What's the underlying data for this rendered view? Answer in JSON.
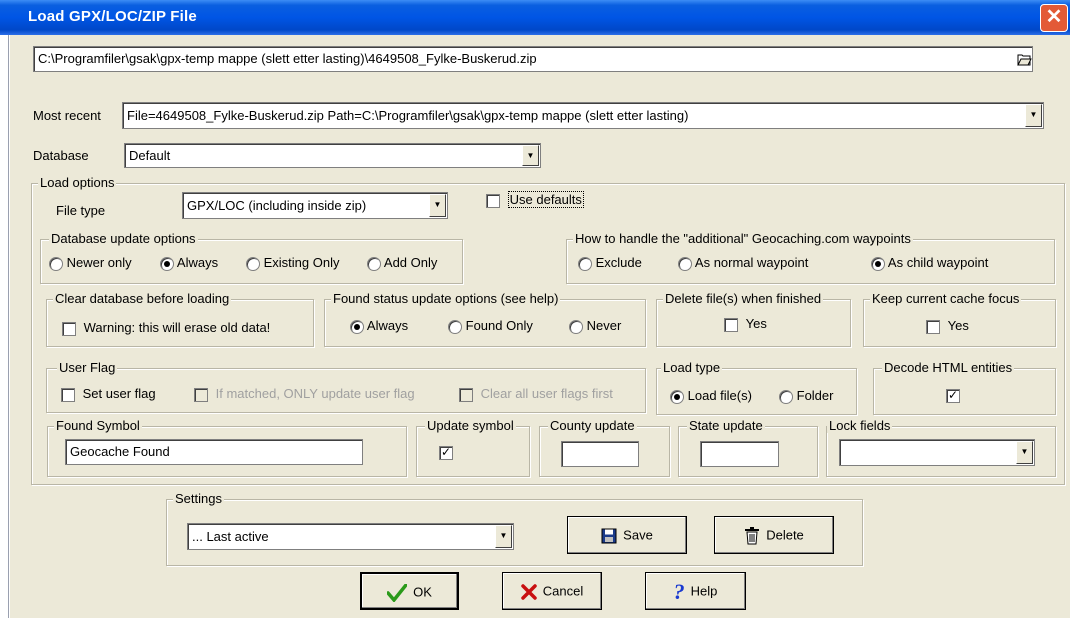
{
  "window": {
    "title": "Load GPX/LOC/ZIP File",
    "close": "✕"
  },
  "file_path": {
    "value": "C:\\Programfiler\\gsak\\gpx-temp mappe (slett etter lasting)\\4649508_Fylke-Buskerud.zip",
    "browse_icon": "folder-open-icon"
  },
  "most_recent": {
    "label": "Most recent",
    "value": "File=4649508_Fylke-Buskerud.zip Path=C:\\Programfiler\\gsak\\gpx-temp mappe (slett etter lasting)"
  },
  "database": {
    "label": "Database",
    "value": "Default"
  },
  "load_options": {
    "legend": "Load options",
    "file_type_label": "File type",
    "file_type_value": "GPX/LOC (including inside zip)",
    "use_defaults": "Use defaults",
    "db_update": {
      "legend": "Database update options",
      "options": [
        "Newer only",
        "Always",
        "Existing Only",
        "Add Only"
      ],
      "selected": "Always"
    },
    "additional_wpts": {
      "legend": "How to handle the \"additional\" Geocaching.com waypoints",
      "options": [
        "Exclude",
        "As normal waypoint",
        "As child waypoint"
      ],
      "selected": "As child waypoint"
    },
    "clear_db": {
      "legend": "Clear database before loading",
      "checkbox": "Warning: this will erase old data!"
    },
    "found_status": {
      "legend": "Found status update options (see help)",
      "options": [
        "Always",
        "Found Only",
        "Never"
      ],
      "selected": "Always"
    },
    "delete_files": {
      "legend": "Delete file(s) when finished",
      "checkbox": "Yes"
    },
    "keep_focus": {
      "legend": "Keep current cache focus",
      "checkbox": "Yes"
    },
    "user_flag": {
      "legend": "User Flag",
      "set": "Set user flag",
      "only_update": "If matched, ONLY update user flag",
      "clear_all": "Clear all user flags first"
    },
    "load_type": {
      "legend": "Load type",
      "options": [
        "Load file(s)",
        "Folder"
      ],
      "selected": "Load file(s)"
    },
    "decode_html": {
      "legend": "Decode HTML entities",
      "checked": true
    },
    "found_symbol": {
      "legend": "Found Symbol",
      "value": "Geocache Found"
    },
    "update_symbol": {
      "legend": "Update symbol",
      "checked": true
    },
    "county_update": {
      "legend": "County update",
      "value": ""
    },
    "state_update": {
      "legend": "State update",
      "value": ""
    },
    "lock_fields": {
      "legend": "Lock fields",
      "value": ""
    }
  },
  "settings": {
    "legend": "Settings",
    "value": "... Last active",
    "save": "Save",
    "delete": "Delete"
  },
  "buttons": {
    "ok": "OK",
    "cancel": "Cancel",
    "help": "Help"
  },
  "colors": {
    "title_bar": "#0055e5",
    "dialog_bg": "#ece9d8",
    "close_button": "#e35a36"
  }
}
